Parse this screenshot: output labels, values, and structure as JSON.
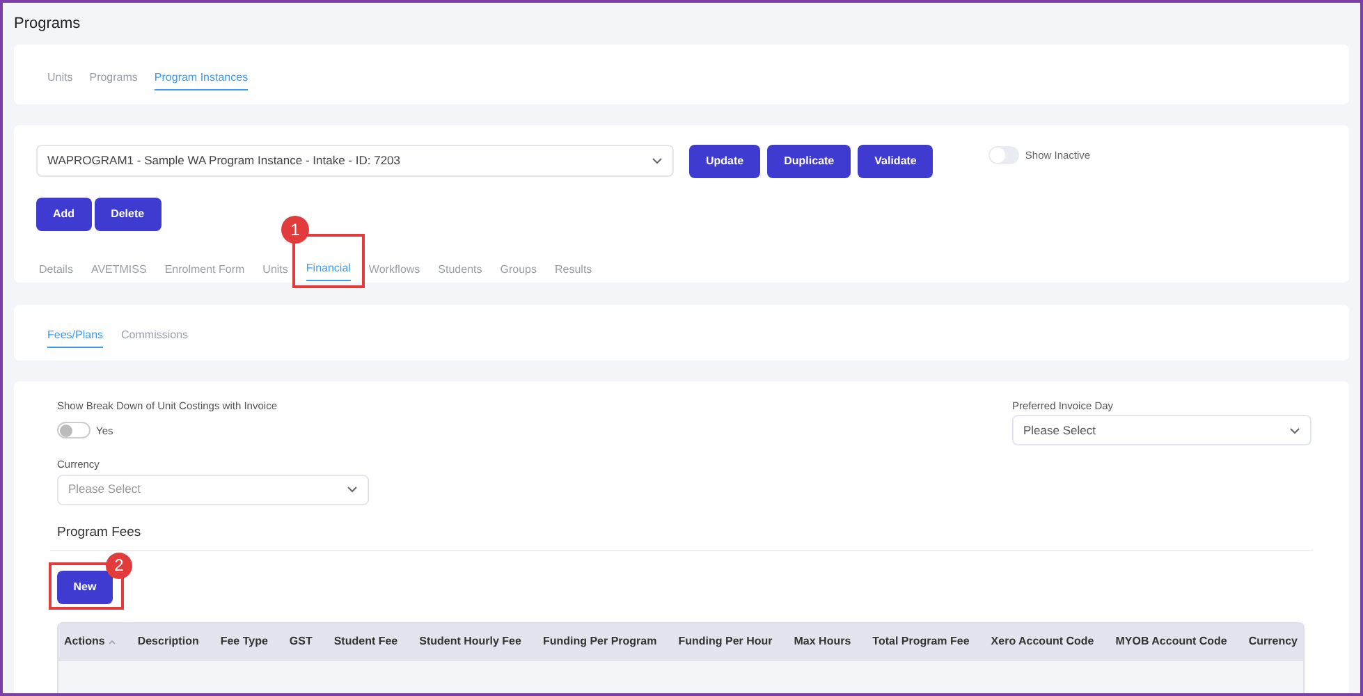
{
  "page_title": "Programs",
  "main_tabs": [
    {
      "label": "Units",
      "selected": false
    },
    {
      "label": "Programs",
      "selected": false
    },
    {
      "label": "Program Instances",
      "selected": true
    }
  ],
  "instance_select": {
    "value": "WAPROGRAM1 - Sample WA Program Instance - Intake - ID: 7203"
  },
  "instance_buttons": [
    "Update",
    "Duplicate",
    "Validate"
  ],
  "show_inactive": {
    "label": "Show Inactive",
    "on": false
  },
  "list_buttons": [
    "Add",
    "Delete"
  ],
  "instance_tabs": [
    {
      "label": "Details",
      "selected": false
    },
    {
      "label": "AVETMISS",
      "selected": false
    },
    {
      "label": "Enrolment Form",
      "selected": false
    },
    {
      "label": "Units",
      "selected": false
    },
    {
      "label": "Financial",
      "selected": true,
      "callout": "1"
    },
    {
      "label": "Workflows",
      "selected": false
    },
    {
      "label": "Students",
      "selected": false
    },
    {
      "label": "Groups",
      "selected": false
    },
    {
      "label": "Results",
      "selected": false
    }
  ],
  "financial_tabs": [
    {
      "label": "Fees/Plans",
      "selected": true
    },
    {
      "label": "Commissions",
      "selected": false
    }
  ],
  "breakdown": {
    "label": "Show Break Down of Unit Costings with Invoice",
    "toggle_label": "Yes",
    "on": false
  },
  "preferred_invoice_day": {
    "label": "Preferred Invoice Day",
    "placeholder": "Please Select"
  },
  "currency": {
    "label": "Currency",
    "placeholder": "Please Select"
  },
  "program_fees": {
    "heading": "Program Fees",
    "new_button": "New",
    "new_callout": "2",
    "columns": [
      "Actions",
      "Description",
      "Fee Type",
      "GST",
      "Student Fee",
      "Student Hourly Fee",
      "Funding Per Program",
      "Funding Per Hour",
      "Max Hours",
      "Total Program Fee",
      "Xero Account Code",
      "MYOB Account Code",
      "Currency"
    ]
  }
}
